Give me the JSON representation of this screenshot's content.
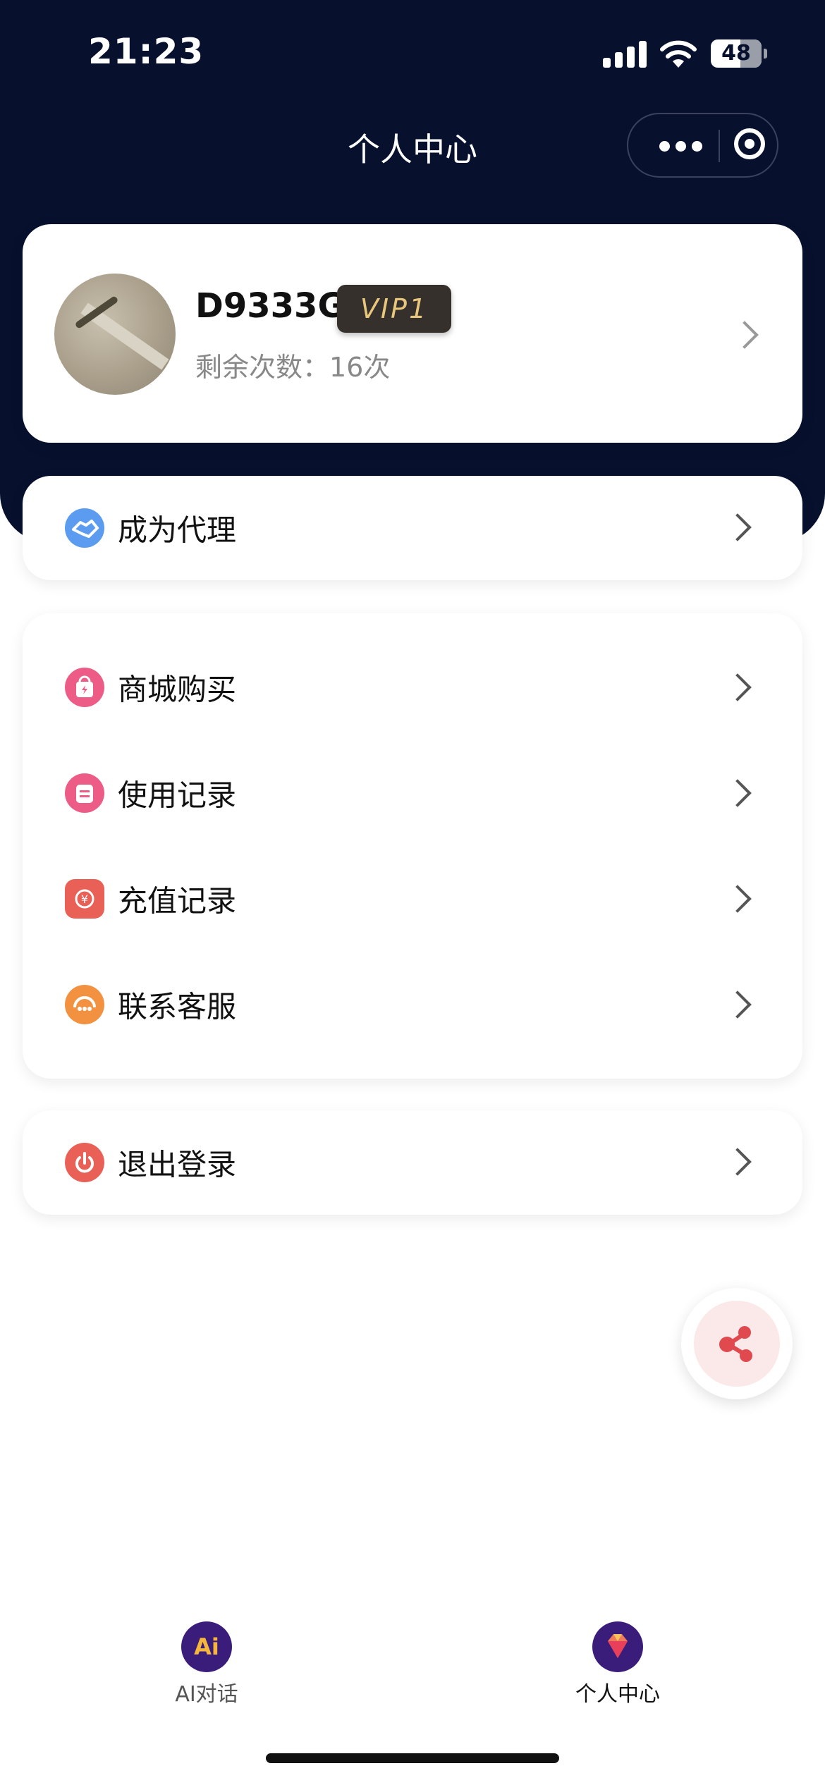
{
  "status_bar": {
    "time": "21:23",
    "battery": "48"
  },
  "nav": {
    "title": "个人中心"
  },
  "profile": {
    "username": "D9333G",
    "vip_badge": "VIP1",
    "remaining": "剩余次数：16次"
  },
  "agent_item": {
    "label": "成为代理",
    "icon": "handshake-icon",
    "color": "#5b9cf0"
  },
  "menu": {
    "items": [
      {
        "label": "商城购买",
        "icon": "shopping-bag-icon",
        "color": "#ec5c86"
      },
      {
        "label": "使用记录",
        "icon": "record-icon",
        "color": "#ec5c86"
      },
      {
        "label": "充值记录",
        "icon": "yuan-refund-icon",
        "color": "#e96057"
      },
      {
        "label": "联系客服",
        "icon": "headset-icon",
        "color": "#f29240"
      }
    ]
  },
  "logout_item": {
    "label": "退出登录",
    "icon": "power-icon",
    "color": "#e96057"
  },
  "tabbar": {
    "tabs": [
      {
        "label": "AI对话",
        "icon": "ai-chat-icon"
      },
      {
        "label": "个人中心",
        "icon": "diamond-icon"
      }
    ]
  },
  "colors": {
    "header_bg": "#07112e",
    "vip_bg": "#36302c",
    "vip_text": "#e8c77c",
    "share": "#e04a4f"
  }
}
